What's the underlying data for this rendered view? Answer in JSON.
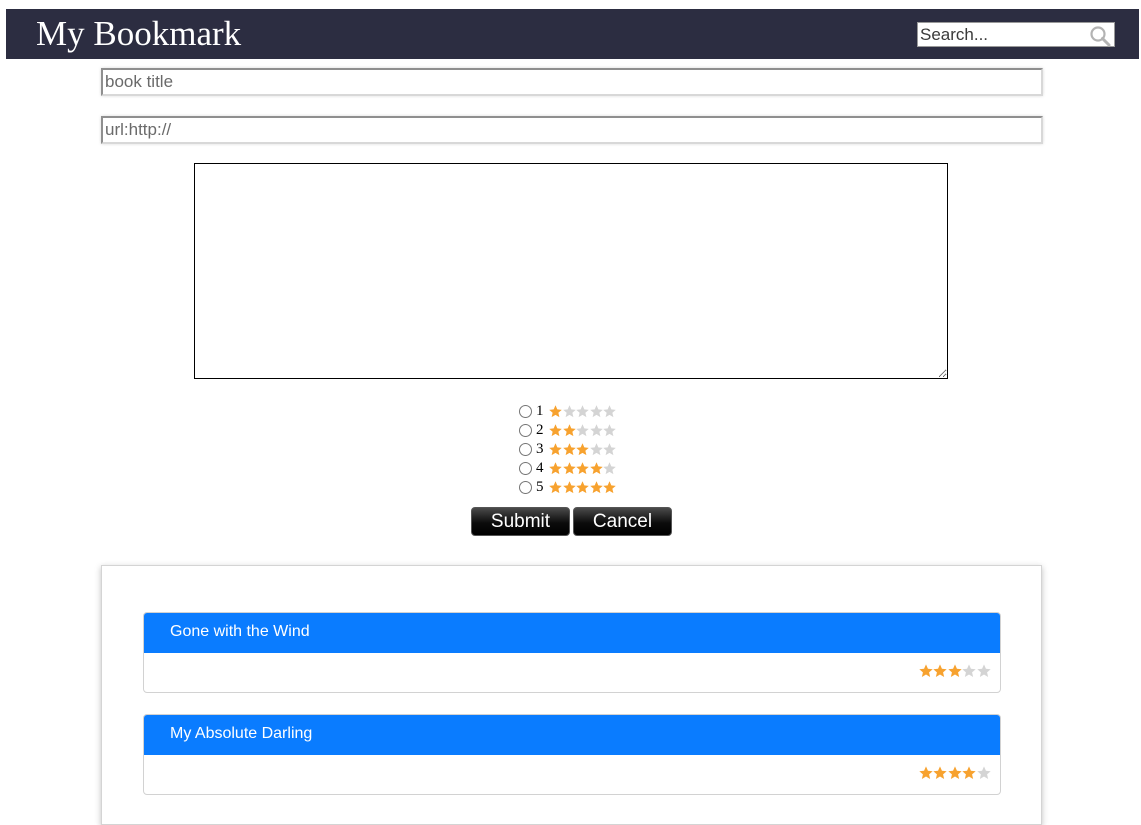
{
  "header": {
    "title": "My Bookmark",
    "search_placeholder": "Search..."
  },
  "form": {
    "title_placeholder": "book title",
    "url_placeholder": "url:http://",
    "notes_value": "",
    "rating_options": [
      {
        "label": "1",
        "stars": 1
      },
      {
        "label": "2",
        "stars": 2
      },
      {
        "label": "3",
        "stars": 3
      },
      {
        "label": "4",
        "stars": 4
      },
      {
        "label": "5",
        "stars": 5
      }
    ],
    "submit_label": "Submit",
    "cancel_label": "Cancel"
  },
  "bookmarks": [
    {
      "title": "Gone with the Wind",
      "rating": 3
    },
    {
      "title": "My Absolute Darling",
      "rating": 4
    }
  ],
  "colors": {
    "header_bg": "#2c2d41",
    "star_filled": "#f7a22f",
    "star_empty": "#d4d4d4",
    "card_header": "#0a7cff"
  },
  "icons": {
    "search": "search-icon",
    "star": "star-icon"
  }
}
